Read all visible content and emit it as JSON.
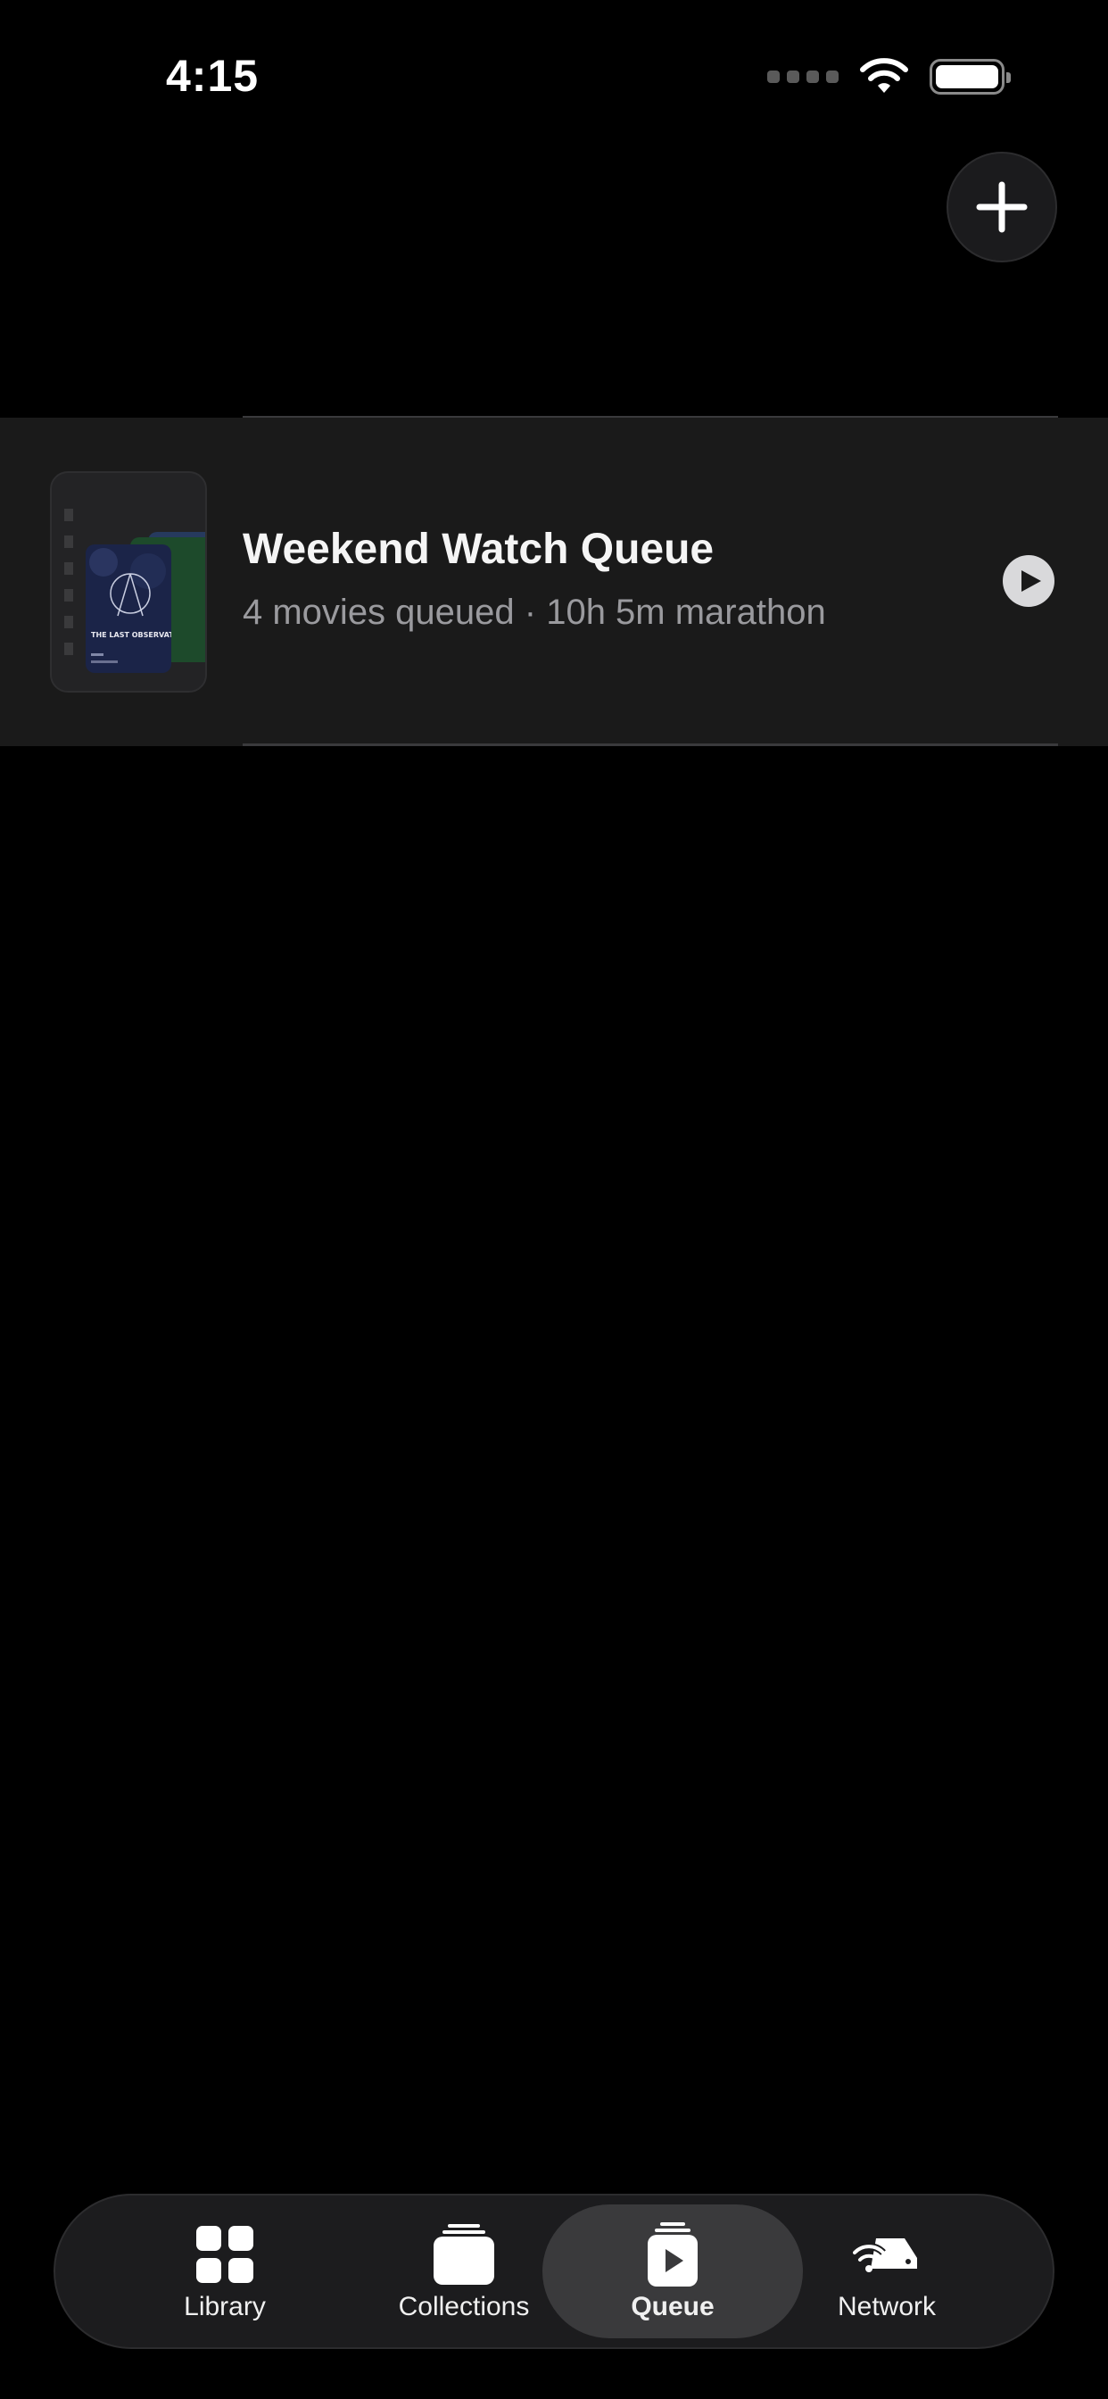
{
  "status_bar": {
    "time": "4:15"
  },
  "queue": {
    "title": "Weekend Watch Queue",
    "subtitle": "4 movies queued · 10h 5m marathon",
    "poster_text": "THE LAST OBSERVATORY"
  },
  "tabs": [
    {
      "label": "Library",
      "icon": "grid-icon",
      "active": false
    },
    {
      "label": "Collections",
      "icon": "stack-icon",
      "active": false
    },
    {
      "label": "Queue",
      "icon": "play-stack-icon",
      "active": true
    },
    {
      "label": "Network",
      "icon": "network-drive-icon",
      "active": false
    }
  ],
  "colors": {
    "background": "#000000",
    "row": "#1a1a1a",
    "active_tab": "#3a3a3c"
  }
}
